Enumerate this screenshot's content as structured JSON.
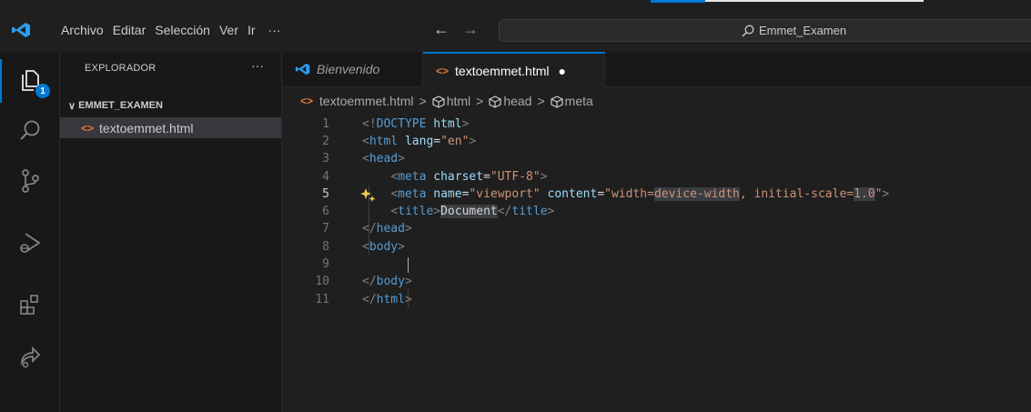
{
  "menu": [
    "Archivo",
    "Editar",
    "Selección",
    "Ver",
    "Ir",
    "···"
  ],
  "nav": {
    "back": "←",
    "forward": "→"
  },
  "command_center": {
    "text": "Emmet_Examen"
  },
  "activity_bar": {
    "explorer_badge": "1"
  },
  "sidebar": {
    "title": "EXPLORADOR",
    "more": "···",
    "folder": "EMMET_EXAMEN",
    "folder_chevron": "∨",
    "file_icon": "<>",
    "files": [
      "textoemmet.html"
    ]
  },
  "tabs": [
    {
      "label": "Bienvenido"
    },
    {
      "label": "textoemmet.html",
      "icon": "<>",
      "modified": "●"
    }
  ],
  "breadcrumb": {
    "file": "textoemmet.html",
    "items": [
      "html",
      "head",
      "meta"
    ],
    "separator": ">"
  },
  "editor": {
    "line_numbers": [
      "1",
      "2",
      "3",
      "4",
      "5",
      "6",
      "7",
      "8",
      "9",
      "10",
      "11"
    ],
    "current_line": "5",
    "lines": [
      [
        {
          "t": "<!",
          "c": "p"
        },
        {
          "t": "DOCTYPE",
          "c": "tag"
        },
        {
          "t": " ",
          "c": "x"
        },
        {
          "t": "html",
          "c": "attr"
        },
        {
          "t": ">",
          "c": "p"
        }
      ],
      [
        {
          "t": "<",
          "c": "p"
        },
        {
          "t": "html",
          "c": "tag"
        },
        {
          "t": " ",
          "c": "x"
        },
        {
          "t": "lang",
          "c": "attr"
        },
        {
          "t": "=",
          "c": "x"
        },
        {
          "t": "\"en\"",
          "c": "str"
        },
        {
          "t": ">",
          "c": "p"
        }
      ],
      [
        {
          "t": "<",
          "c": "p"
        },
        {
          "t": "head",
          "c": "tag"
        },
        {
          "t": ">",
          "c": "p"
        }
      ],
      [
        {
          "t": "    ",
          "c": "x"
        },
        {
          "t": "<",
          "c": "p"
        },
        {
          "t": "meta",
          "c": "tag"
        },
        {
          "t": " ",
          "c": "x"
        },
        {
          "t": "charset",
          "c": "attr"
        },
        {
          "t": "=",
          "c": "x"
        },
        {
          "t": "\"UTF-8\"",
          "c": "str"
        },
        {
          "t": ">",
          "c": "p"
        }
      ],
      [
        {
          "t": "    ",
          "c": "x"
        },
        {
          "t": "<",
          "c": "p"
        },
        {
          "t": "meta",
          "c": "tag"
        },
        {
          "t": " ",
          "c": "x"
        },
        {
          "t": "name",
          "c": "attr"
        },
        {
          "t": "=",
          "c": "x"
        },
        {
          "t": "\"viewport\"",
          "c": "str"
        },
        {
          "t": " ",
          "c": "x"
        },
        {
          "t": "content",
          "c": "attr"
        },
        {
          "t": "=",
          "c": "x"
        },
        {
          "t": "\"width=",
          "c": "str"
        },
        {
          "t": "device-width",
          "c": "strhl"
        },
        {
          "t": ", initial-scale=",
          "c": "str"
        },
        {
          "t": "1.0",
          "c": "strhl"
        },
        {
          "t": "\"",
          "c": "str"
        },
        {
          "t": ">",
          "c": "p"
        }
      ],
      [
        {
          "t": "    ",
          "c": "x"
        },
        {
          "t": "<",
          "c": "p"
        },
        {
          "t": "title",
          "c": "tag"
        },
        {
          "t": ">",
          "c": "p"
        },
        {
          "t": "Document",
          "c": "texthl"
        },
        {
          "t": "</",
          "c": "p"
        },
        {
          "t": "title",
          "c": "tag"
        },
        {
          "t": ">",
          "c": "p"
        }
      ],
      [
        {
          "t": "</",
          "c": "p"
        },
        {
          "t": "head",
          "c": "tag"
        },
        {
          "t": ">",
          "c": "p"
        }
      ],
      [
        {
          "t": "<",
          "c": "p"
        },
        {
          "t": "body",
          "c": "tag"
        },
        {
          "t": ">",
          "c": "p"
        }
      ],
      [],
      [
        {
          "t": "</",
          "c": "p"
        },
        {
          "t": "body",
          "c": "tag"
        },
        {
          "t": ">",
          "c": "p"
        }
      ],
      [
        {
          "t": "</",
          "c": "p"
        },
        {
          "t": "html",
          "c": "tag"
        },
        {
          "t": ">",
          "c": "p"
        }
      ]
    ]
  },
  "colors": {
    "accent": "#0078d4",
    "html_icon": "#e37933",
    "tag": "#569cd6",
    "attr": "#9cdcfe",
    "string": "#ce9178",
    "sparkle": "#f2c94c"
  }
}
